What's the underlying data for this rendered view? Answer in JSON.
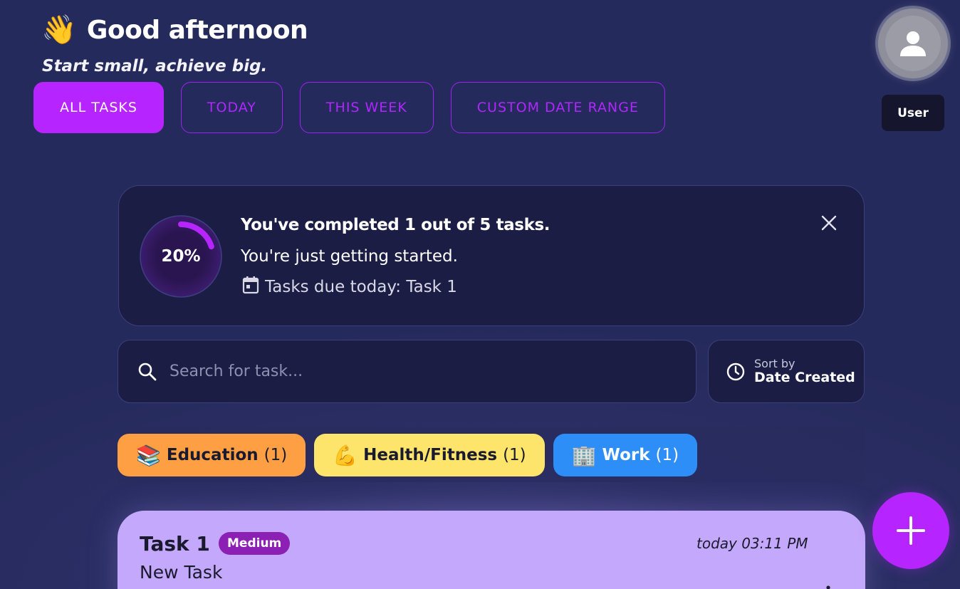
{
  "header": {
    "wave_emoji": "👋",
    "greeting": "Good afternoon",
    "subtitle": "Start small, achieve big."
  },
  "tabs": [
    {
      "label": "ALL TASKS",
      "active": true
    },
    {
      "label": "TODAY",
      "active": false
    },
    {
      "label": "THIS WEEK",
      "active": false
    },
    {
      "label": "CUSTOM DATE RANGE",
      "active": false
    }
  ],
  "user": {
    "avatar_icon": "person-icon",
    "name": "User"
  },
  "progress": {
    "percent_label": "20%",
    "percent_value": 0.2,
    "title": "You've completed 1 out of 5 tasks.",
    "message": "You're just getting started.",
    "due_today": "Tasks due today: Task 1",
    "due_icon": "calendar-icon",
    "close_icon": "close-icon"
  },
  "search": {
    "placeholder": "Search for task...",
    "value": "",
    "icon": "search-icon"
  },
  "sort": {
    "caption": "Sort by",
    "value": "Date Created",
    "icon": "clock-icon"
  },
  "categories": [
    {
      "emoji": "📚",
      "name": "Education",
      "count": "(1)",
      "color": "#ff9f43"
    },
    {
      "emoji": "💪",
      "name": "Health/Fitness",
      "count": "(1)",
      "color": "#fde46b"
    },
    {
      "emoji": "🏢",
      "name": "Work",
      "count": "(1)",
      "color": "#2e8ef7"
    }
  ],
  "tasks": [
    {
      "name": "Task 1",
      "priority": "Medium",
      "date": "today 03:11 PM",
      "description": "New Task",
      "color": "#c4a8fb"
    }
  ],
  "fab": {
    "icon": "plus-icon"
  },
  "colors": {
    "accent": "#b624ff",
    "background": "#2c2f66",
    "card": "#1b1d45"
  }
}
